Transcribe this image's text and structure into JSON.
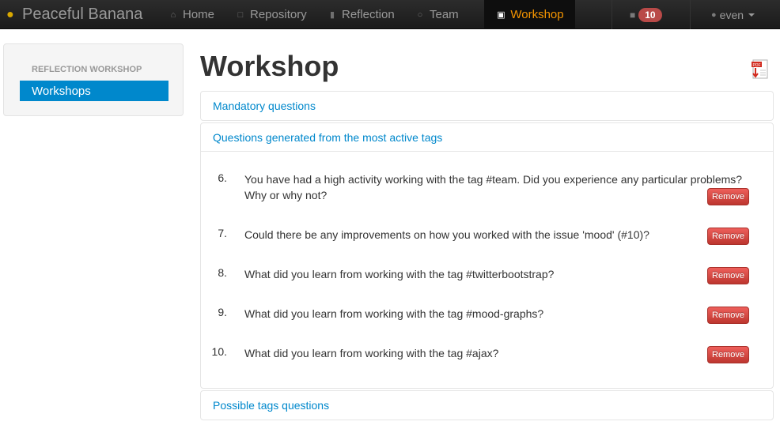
{
  "navbar": {
    "brand": "Peaceful Banana",
    "items": [
      {
        "label": "Home",
        "icon": "home-icon"
      },
      {
        "label": "Repository",
        "icon": "folder-icon"
      },
      {
        "label": "Reflection",
        "icon": "book-icon"
      },
      {
        "label": "Team",
        "icon": "globe-icon"
      },
      {
        "label": "Workshop",
        "icon": "briefcase-icon",
        "active": true
      }
    ],
    "notifications_count": "10",
    "user": "even",
    "active_color": "#f59500",
    "badge_color": "#b94a48"
  },
  "sidebar": {
    "header": "REFLECTION WORKSHOP",
    "items": [
      {
        "label": "Workshops",
        "active": true
      }
    ],
    "active_color": "#0088cc"
  },
  "main": {
    "title": "Workshop",
    "panels": [
      {
        "title": "Mandatory questions"
      },
      {
        "title": "Questions generated from the most active tags"
      },
      {
        "title": "Possible tags questions"
      }
    ],
    "remove_label": "Remove",
    "questions": [
      {
        "num": "6.",
        "text": "You have had a high activity working with the tag #team. Did you experience any particular problems? Why or why not?"
      },
      {
        "num": "7.",
        "text": "Could there be any improvements on how you worked with the issue 'mood' (#10)?"
      },
      {
        "num": "8.",
        "text": "What did you learn from working with the tag #twitterbootstrap?"
      },
      {
        "num": "9.",
        "text": "What did you learn from working with the tag #mood-graphs?"
      },
      {
        "num": "10.",
        "text": "What did you learn from working with the tag #ajax?"
      }
    ],
    "link_color": "#0088cc",
    "button_color": "#da4f49"
  }
}
